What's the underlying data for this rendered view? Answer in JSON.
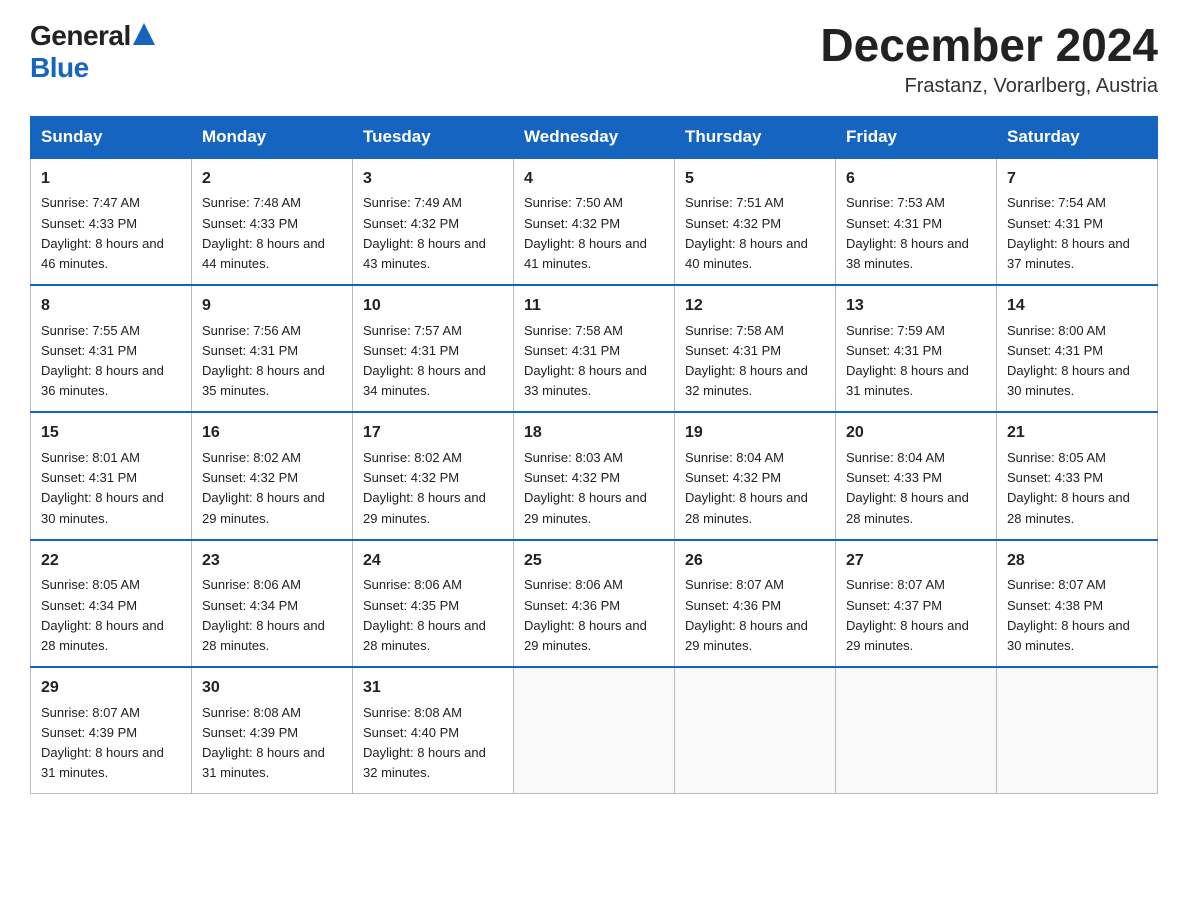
{
  "logo": {
    "general": "General",
    "blue": "Blue"
  },
  "title": {
    "month": "December 2024",
    "location": "Frastanz, Vorarlberg, Austria"
  },
  "days_of_week": [
    "Sunday",
    "Monday",
    "Tuesday",
    "Wednesday",
    "Thursday",
    "Friday",
    "Saturday"
  ],
  "weeks": [
    [
      {
        "day": "1",
        "sunrise": "7:47 AM",
        "sunset": "4:33 PM",
        "daylight": "8 hours and 46 minutes."
      },
      {
        "day": "2",
        "sunrise": "7:48 AM",
        "sunset": "4:33 PM",
        "daylight": "8 hours and 44 minutes."
      },
      {
        "day": "3",
        "sunrise": "7:49 AM",
        "sunset": "4:32 PM",
        "daylight": "8 hours and 43 minutes."
      },
      {
        "day": "4",
        "sunrise": "7:50 AM",
        "sunset": "4:32 PM",
        "daylight": "8 hours and 41 minutes."
      },
      {
        "day": "5",
        "sunrise": "7:51 AM",
        "sunset": "4:32 PM",
        "daylight": "8 hours and 40 minutes."
      },
      {
        "day": "6",
        "sunrise": "7:53 AM",
        "sunset": "4:31 PM",
        "daylight": "8 hours and 38 minutes."
      },
      {
        "day": "7",
        "sunrise": "7:54 AM",
        "sunset": "4:31 PM",
        "daylight": "8 hours and 37 minutes."
      }
    ],
    [
      {
        "day": "8",
        "sunrise": "7:55 AM",
        "sunset": "4:31 PM",
        "daylight": "8 hours and 36 minutes."
      },
      {
        "day": "9",
        "sunrise": "7:56 AM",
        "sunset": "4:31 PM",
        "daylight": "8 hours and 35 minutes."
      },
      {
        "day": "10",
        "sunrise": "7:57 AM",
        "sunset": "4:31 PM",
        "daylight": "8 hours and 34 minutes."
      },
      {
        "day": "11",
        "sunrise": "7:58 AM",
        "sunset": "4:31 PM",
        "daylight": "8 hours and 33 minutes."
      },
      {
        "day": "12",
        "sunrise": "7:58 AM",
        "sunset": "4:31 PM",
        "daylight": "8 hours and 32 minutes."
      },
      {
        "day": "13",
        "sunrise": "7:59 AM",
        "sunset": "4:31 PM",
        "daylight": "8 hours and 31 minutes."
      },
      {
        "day": "14",
        "sunrise": "8:00 AM",
        "sunset": "4:31 PM",
        "daylight": "8 hours and 30 minutes."
      }
    ],
    [
      {
        "day": "15",
        "sunrise": "8:01 AM",
        "sunset": "4:31 PM",
        "daylight": "8 hours and 30 minutes."
      },
      {
        "day": "16",
        "sunrise": "8:02 AM",
        "sunset": "4:32 PM",
        "daylight": "8 hours and 29 minutes."
      },
      {
        "day": "17",
        "sunrise": "8:02 AM",
        "sunset": "4:32 PM",
        "daylight": "8 hours and 29 minutes."
      },
      {
        "day": "18",
        "sunrise": "8:03 AM",
        "sunset": "4:32 PM",
        "daylight": "8 hours and 29 minutes."
      },
      {
        "day": "19",
        "sunrise": "8:04 AM",
        "sunset": "4:32 PM",
        "daylight": "8 hours and 28 minutes."
      },
      {
        "day": "20",
        "sunrise": "8:04 AM",
        "sunset": "4:33 PM",
        "daylight": "8 hours and 28 minutes."
      },
      {
        "day": "21",
        "sunrise": "8:05 AM",
        "sunset": "4:33 PM",
        "daylight": "8 hours and 28 minutes."
      }
    ],
    [
      {
        "day": "22",
        "sunrise": "8:05 AM",
        "sunset": "4:34 PM",
        "daylight": "8 hours and 28 minutes."
      },
      {
        "day": "23",
        "sunrise": "8:06 AM",
        "sunset": "4:34 PM",
        "daylight": "8 hours and 28 minutes."
      },
      {
        "day": "24",
        "sunrise": "8:06 AM",
        "sunset": "4:35 PM",
        "daylight": "8 hours and 28 minutes."
      },
      {
        "day": "25",
        "sunrise": "8:06 AM",
        "sunset": "4:36 PM",
        "daylight": "8 hours and 29 minutes."
      },
      {
        "day": "26",
        "sunrise": "8:07 AM",
        "sunset": "4:36 PM",
        "daylight": "8 hours and 29 minutes."
      },
      {
        "day": "27",
        "sunrise": "8:07 AM",
        "sunset": "4:37 PM",
        "daylight": "8 hours and 29 minutes."
      },
      {
        "day": "28",
        "sunrise": "8:07 AM",
        "sunset": "4:38 PM",
        "daylight": "8 hours and 30 minutes."
      }
    ],
    [
      {
        "day": "29",
        "sunrise": "8:07 AM",
        "sunset": "4:39 PM",
        "daylight": "8 hours and 31 minutes."
      },
      {
        "day": "30",
        "sunrise": "8:08 AM",
        "sunset": "4:39 PM",
        "daylight": "8 hours and 31 minutes."
      },
      {
        "day": "31",
        "sunrise": "8:08 AM",
        "sunset": "4:40 PM",
        "daylight": "8 hours and 32 minutes."
      },
      null,
      null,
      null,
      null
    ]
  ]
}
